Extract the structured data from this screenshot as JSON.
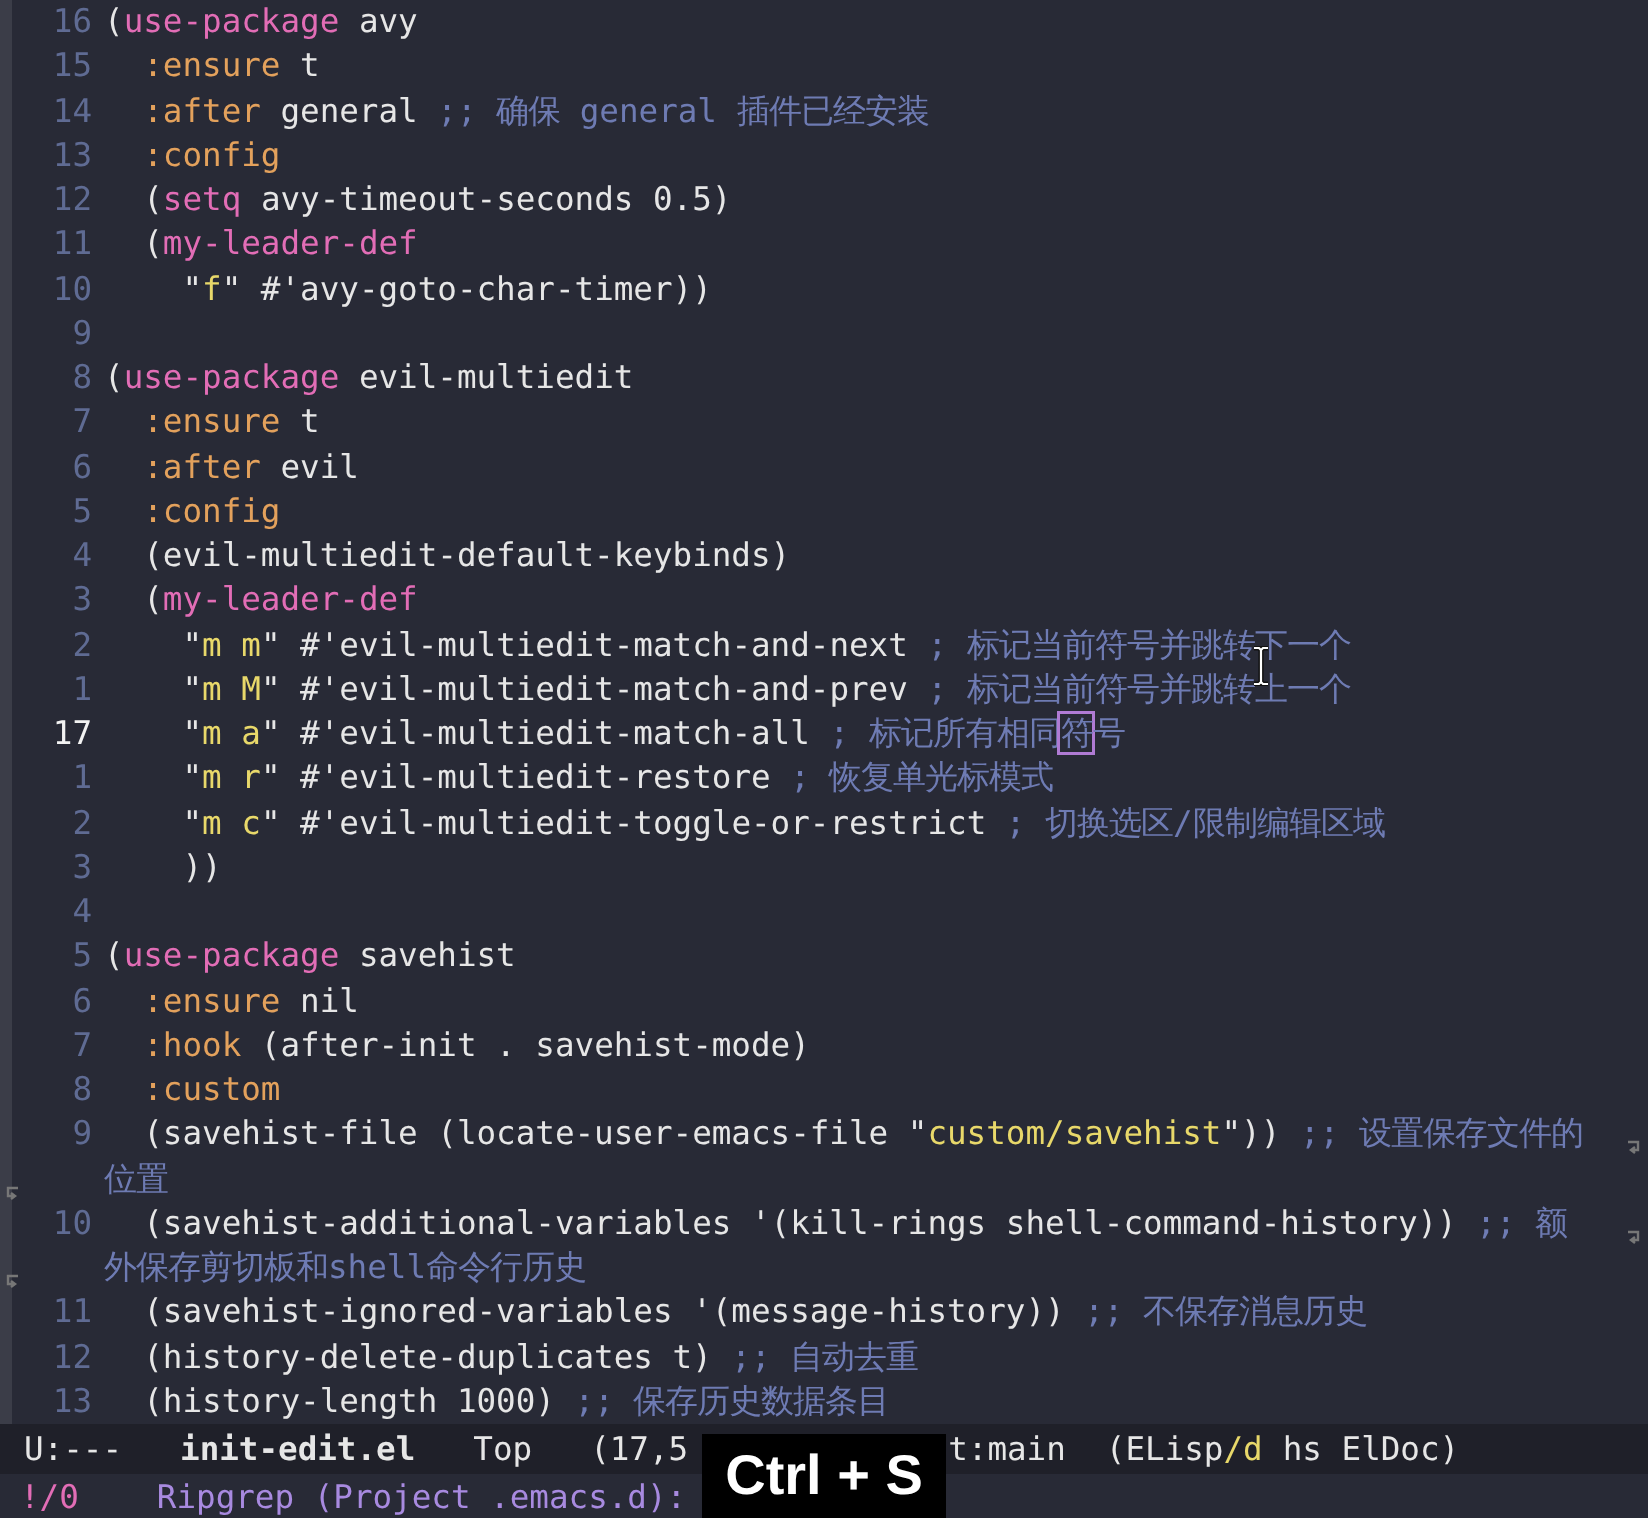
{
  "buffer": {
    "lines": [
      {
        "kind": "code",
        "number": "16",
        "current": false,
        "wraps": false,
        "tokens": [
          {
            "text": "(",
            "kind": "plain"
          },
          {
            "text": "use-package",
            "kind": "keyword"
          },
          {
            "text": " avy",
            "kind": "plain"
          }
        ]
      },
      {
        "kind": "code",
        "number": "15",
        "current": false,
        "wraps": false,
        "tokens": [
          {
            "text": "  :ensure",
            "kind": "builtin"
          },
          {
            "text": " t",
            "kind": "plain"
          }
        ]
      },
      {
        "kind": "code",
        "number": "14",
        "current": false,
        "wraps": false,
        "tokens": [
          {
            "text": "  :after",
            "kind": "builtin"
          },
          {
            "text": " general ",
            "kind": "plain"
          },
          {
            "text": ";; 确保 general 插件已经安装",
            "kind": "comment"
          }
        ]
      },
      {
        "kind": "code",
        "number": "13",
        "current": false,
        "wraps": false,
        "tokens": [
          {
            "text": "  :config",
            "kind": "builtin"
          }
        ]
      },
      {
        "kind": "code",
        "number": "12",
        "current": false,
        "wraps": false,
        "tokens": [
          {
            "text": "  (",
            "kind": "plain"
          },
          {
            "text": "setq",
            "kind": "keyword"
          },
          {
            "text": " avy-timeout-seconds 0.5)",
            "kind": "plain"
          }
        ]
      },
      {
        "kind": "code",
        "number": "11",
        "current": false,
        "wraps": false,
        "tokens": [
          {
            "text": "  (",
            "kind": "plain"
          },
          {
            "text": "my-leader-def",
            "kind": "keyword"
          }
        ]
      },
      {
        "kind": "code",
        "number": "10",
        "current": false,
        "wraps": false,
        "tokens": [
          {
            "text": "    \"",
            "kind": "plain"
          },
          {
            "text": "f",
            "kind": "string"
          },
          {
            "text": "\" #'avy-goto-char-timer))",
            "kind": "plain"
          }
        ]
      },
      {
        "kind": "code",
        "number": "9",
        "current": false,
        "wraps": false
      },
      {
        "kind": "code",
        "number": "8",
        "current": false,
        "wraps": false,
        "tokens": [
          {
            "text": "(",
            "kind": "plain"
          },
          {
            "text": "use-package",
            "kind": "keyword"
          },
          {
            "text": " evil-multiedit",
            "kind": "plain"
          }
        ]
      },
      {
        "kind": "code",
        "number": "7",
        "current": false,
        "wraps": false,
        "tokens": [
          {
            "text": "  :ensure",
            "kind": "builtin"
          },
          {
            "text": " t",
            "kind": "plain"
          }
        ]
      },
      {
        "kind": "code",
        "number": "6",
        "current": false,
        "wraps": false,
        "tokens": [
          {
            "text": "  :after",
            "kind": "builtin"
          },
          {
            "text": " evil",
            "kind": "plain"
          }
        ]
      },
      {
        "kind": "code",
        "number": "5",
        "current": false,
        "wraps": false,
        "tokens": [
          {
            "text": "  :config",
            "kind": "builtin"
          }
        ]
      },
      {
        "kind": "code",
        "number": "4",
        "current": false,
        "wraps": false,
        "tokens": [
          {
            "text": "  (evil-multiedit-default-keybinds)",
            "kind": "plain"
          }
        ]
      },
      {
        "kind": "code",
        "number": "3",
        "current": false,
        "wraps": false,
        "tokens": [
          {
            "text": "  (",
            "kind": "plain"
          },
          {
            "text": "my-leader-def",
            "kind": "keyword"
          }
        ]
      },
      {
        "kind": "code",
        "number": "2",
        "current": false,
        "wraps": false,
        "tokens": [
          {
            "text": "    \"",
            "kind": "plain"
          },
          {
            "text": "m m",
            "kind": "string"
          },
          {
            "text": "\" #'evil-multiedit-match-and-next ",
            "kind": "plain"
          },
          {
            "text": "; 标记当前符号并跳转下一个",
            "kind": "comment"
          }
        ]
      },
      {
        "kind": "code",
        "number": "1",
        "current": false,
        "wraps": false,
        "tokens": [
          {
            "text": "    \"",
            "kind": "plain"
          },
          {
            "text": "m M",
            "kind": "string"
          },
          {
            "text": "\" #'evil-multiedit-match-and-prev ",
            "kind": "plain"
          },
          {
            "text": "; 标记当前符号并跳转上一个",
            "kind": "comment"
          }
        ]
      },
      {
        "kind": "code",
        "number": "17",
        "current": true,
        "wraps": false,
        "tokens": [
          {
            "text": "    \"",
            "kind": "plain"
          },
          {
            "text": "m a",
            "kind": "string"
          },
          {
            "text": "\" #'evil-multiedit-match-all ",
            "kind": "plain"
          },
          {
            "text": "; 标记所有相同",
            "kind": "comment"
          },
          {
            "text": "符",
            "kind": "cursor"
          },
          {
            "text": "号",
            "kind": "comment"
          }
        ]
      },
      {
        "kind": "code",
        "number": "1",
        "current": false,
        "wraps": false,
        "tokens": [
          {
            "text": "    \"",
            "kind": "plain"
          },
          {
            "text": "m r",
            "kind": "string"
          },
          {
            "text": "\" #'evil-multiedit-restore ",
            "kind": "plain"
          },
          {
            "text": "; 恢复单光标模式",
            "kind": "comment"
          }
        ]
      },
      {
        "kind": "code",
        "number": "2",
        "current": false,
        "wraps": false,
        "tokens": [
          {
            "text": "    \"",
            "kind": "plain"
          },
          {
            "text": "m c",
            "kind": "string"
          },
          {
            "text": "\" #'evil-multiedit-toggle-or-restrict ",
            "kind": "plain"
          },
          {
            "text": "; 切换选区/限制编辑区域",
            "kind": "comment"
          }
        ]
      },
      {
        "kind": "code",
        "number": "3",
        "current": false,
        "wraps": false,
        "tokens": [
          {
            "text": "    ))",
            "kind": "plain"
          }
        ]
      },
      {
        "kind": "code",
        "number": "4",
        "current": false,
        "wraps": false
      },
      {
        "kind": "code",
        "number": "5",
        "current": false,
        "wraps": false,
        "tokens": [
          {
            "text": "(",
            "kind": "plain"
          },
          {
            "text": "use-package",
            "kind": "keyword"
          },
          {
            "text": " savehist",
            "kind": "plain"
          }
        ]
      },
      {
        "kind": "code",
        "number": "6",
        "current": false,
        "wraps": false,
        "tokens": [
          {
            "text": "  :ensure",
            "kind": "builtin"
          },
          {
            "text": " nil",
            "kind": "plain"
          }
        ]
      },
      {
        "kind": "code",
        "number": "7",
        "current": false,
        "wraps": false,
        "tokens": [
          {
            "text": "  :hook",
            "kind": "builtin"
          },
          {
            "text": " (after-init . savehist-mode)",
            "kind": "plain"
          }
        ]
      },
      {
        "kind": "code",
        "number": "8",
        "current": false,
        "wraps": false,
        "tokens": [
          {
            "text": "  :custom",
            "kind": "builtin"
          }
        ]
      },
      {
        "kind": "code",
        "number": "9",
        "current": false,
        "wraps": true,
        "tokens": [
          {
            "text": "  (savehist-file (locate-user-emacs-file \"",
            "kind": "plain"
          },
          {
            "text": "custom/savehist",
            "kind": "string"
          },
          {
            "text": "\")) ",
            "kind": "plain"
          },
          {
            "text": ";; 设置保存文件的",
            "kind": "comment"
          }
        ]
      },
      {
        "kind": "continuation",
        "tokens": [
          {
            "text": "位置",
            "kind": "comment"
          }
        ]
      },
      {
        "kind": "code",
        "number": "10",
        "current": false,
        "wraps": true,
        "tokens": [
          {
            "text": "  (savehist-additional-variables '(kill-rings shell-command-history)) ",
            "kind": "plain"
          },
          {
            "text": ";; 额",
            "kind": "comment"
          }
        ]
      },
      {
        "kind": "continuation",
        "tokens": [
          {
            "text": "外保存剪切板和shell命令行历史",
            "kind": "comment"
          }
        ]
      },
      {
        "kind": "code",
        "number": "11",
        "current": false,
        "wraps": false,
        "tokens": [
          {
            "text": "  (savehist-ignored-variables '(message-history)) ",
            "kind": "plain"
          },
          {
            "text": ";; 不保存消息历史",
            "kind": "comment"
          }
        ]
      },
      {
        "kind": "code",
        "number": "12",
        "current": false,
        "wraps": false,
        "tokens": [
          {
            "text": "  (history-delete-duplicates t) ",
            "kind": "plain"
          },
          {
            "text": ";; 自动去重",
            "kind": "comment"
          }
        ]
      },
      {
        "kind": "code",
        "number": "13",
        "current": false,
        "wraps": false,
        "tokens": [
          {
            "text": "  (history-length 1000) ",
            "kind": "plain"
          },
          {
            "text": ";; 保存历史数据条目",
            "kind": "comment"
          }
        ]
      }
    ]
  },
  "mode_line": [
    {
      "text": "U:---",
      "kind": "plain"
    },
    {
      "text": "init-edit.el",
      "kind": "buffer"
    },
    {
      "text": "Top",
      "kind": "plain"
    },
    {
      "text": "(17,5",
      "kind": "plain"
    },
    {
      "text": "t:main",
      "kind": "plain"
    },
    {
      "text": "(ELisp",
      "kind": "plain"
    },
    {
      "text": "/d",
      "kind": "accent"
    },
    {
      "text": "hs ElDoc)",
      "kind": "plain"
    }
  ],
  "echo_area": {
    "count": "!/0",
    "prompt": "Ripgrep (Project .emacs.d):"
  },
  "key_overlay": "Ctrl + S"
}
